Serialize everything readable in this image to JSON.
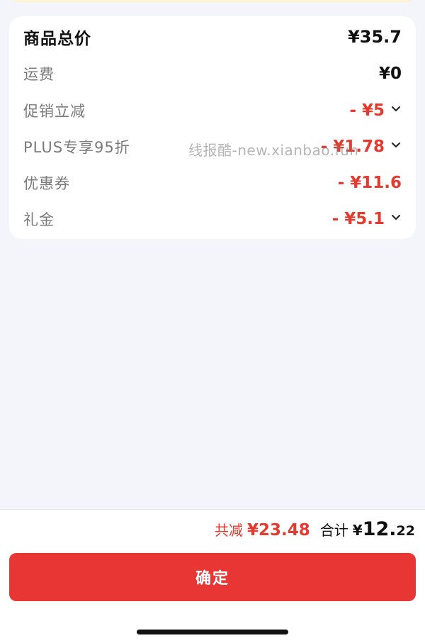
{
  "price_card": {
    "rows": [
      {
        "label": "商品总价",
        "value": "¥35.7"
      },
      {
        "label": "运费",
        "value": "¥0"
      },
      {
        "label": "促销立减",
        "value": "- ¥5"
      },
      {
        "label": "PLUS专享95折",
        "value": "- ¥1.78"
      },
      {
        "label": "优惠券",
        "value": "- ¥11.6"
      },
      {
        "label": "礼金",
        "value": "- ¥5.1"
      }
    ]
  },
  "watermark": "线报酷-new.xianbao.fun",
  "summary": {
    "discount_label": "共减",
    "discount_value": "¥23.48",
    "total_label": "合计",
    "total_currency": "¥",
    "total_integer": "12.",
    "total_decimal": "22"
  },
  "confirm_button": {
    "label": "确定"
  },
  "icons": {
    "expand": "chevron-down-icon"
  },
  "colors": {
    "accent": "#e53a2f",
    "button": "#e73634",
    "background": "#f4f5fa"
  }
}
